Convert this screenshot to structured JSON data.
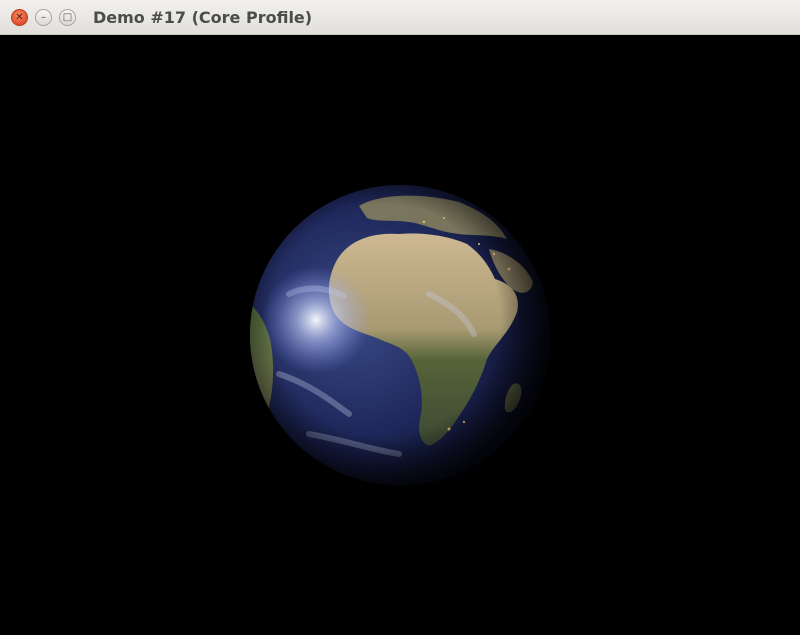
{
  "window": {
    "title": "Demo #17 (Core Profile)",
    "controls": {
      "close_glyph": "✕",
      "minimize_glyph": "–",
      "maximize_glyph": "□"
    },
    "colors": {
      "close_button": "#e0502a",
      "titlebar": "#e8e6e3",
      "viewport_background": "#000000"
    }
  },
  "scene": {
    "object": "earth-globe",
    "colors": {
      "ocean": "#1b2350",
      "land_desert": "#c9b48a",
      "land_vegetation": "#4f5d36",
      "specular_highlight": "#ffffff"
    }
  }
}
